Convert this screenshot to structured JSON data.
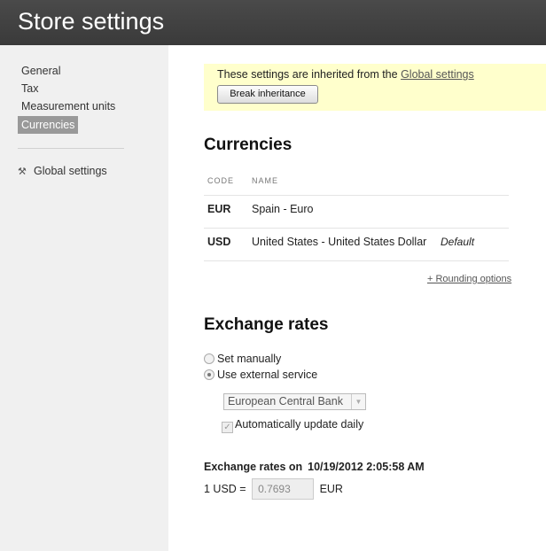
{
  "header": {
    "title": "Store settings"
  },
  "sidebar": {
    "items": [
      {
        "label": "General"
      },
      {
        "label": "Tax"
      },
      {
        "label": "Measurement units"
      },
      {
        "label": "Currencies",
        "active": true
      }
    ],
    "global": {
      "icon": "tools-icon",
      "label": "Global settings"
    }
  },
  "notice": {
    "text": "These settings are inherited from the ",
    "link": "Global settings",
    "button": "Break inheritance",
    "bg_color": "#ffffcc"
  },
  "currencies": {
    "title": "Currencies",
    "columns": [
      "CODE",
      "NAME"
    ],
    "rows": [
      {
        "code": "EUR",
        "name": "Spain - Euro",
        "tag": ""
      },
      {
        "code": "USD",
        "name": "United States - United States Dollar",
        "tag": "Default"
      }
    ],
    "rounding_link": "+ Rounding options"
  },
  "exchange": {
    "title": "Exchange rates",
    "options": [
      {
        "label": "Set manually",
        "checked": false
      },
      {
        "label": "Use external service",
        "checked": true
      }
    ],
    "service": "European Central Bank",
    "auto_update_label": "Automatically update daily",
    "auto_update": true,
    "rates_label": "Exchange rates on",
    "rates_date": "10/19/2012 2:05:58 AM",
    "rate_prefix": "1 USD =",
    "rate_value": "0.7693",
    "rate_suffix": "EUR"
  }
}
